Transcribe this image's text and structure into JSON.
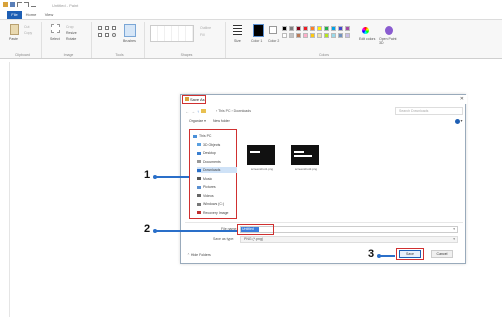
{
  "app": {
    "title": "Untitled - Paint"
  },
  "menu": {
    "file": "File",
    "tabs": [
      "Home",
      "View"
    ]
  },
  "ribbon": {
    "groups": [
      "Clipboard",
      "Image",
      "Tools",
      "Shapes",
      "Colors"
    ],
    "clipboard": {
      "paste": "Paste",
      "cut": "Cut",
      "copy": "Copy"
    },
    "image": {
      "select": "Select",
      "crop": "Crop",
      "resize": "Resize",
      "rotate": "Rotate"
    },
    "tools": {
      "brushes": "Brushes"
    },
    "shapes": {
      "outline": "Outline",
      "fill": "Fill"
    },
    "size_label": "Size",
    "color1_label": "Color 1",
    "color2_label": "Color 2",
    "edit_colors": "Edit colors",
    "paint3d": "Open Paint 3D",
    "palette": [
      "#000000",
      "#7f7f7f",
      "#880015",
      "#ed1c24",
      "#ff7f27",
      "#fff200",
      "#22b14c",
      "#00a2e8",
      "#3f48cc",
      "#a349a4",
      "#ffffff",
      "#c3c3c3",
      "#b97a57",
      "#ffaec9",
      "#ffc90e",
      "#efe4b0",
      "#b5e61d",
      "#99d9ea",
      "#7092be",
      "#c8bfe7"
    ]
  },
  "dialog": {
    "title": "Save As",
    "close_glyph": "✕",
    "nav_back": "←",
    "nav_forward": "→",
    "nav_up": "↑",
    "path": "› This PC › Downloads",
    "search_placeholder": "Search Downloads",
    "organize": "Organize ▾",
    "new_folder": "New folder",
    "view_glyph": "≡ ▾",
    "nav_items": [
      {
        "label": "This PC",
        "color": "#4a90d9"
      },
      {
        "label": "3D Objects",
        "color": "#5aa0e0"
      },
      {
        "label": "Desktop",
        "color": "#3a7fd0"
      },
      {
        "label": "Documents",
        "color": "#999999"
      },
      {
        "label": "Downloads",
        "color": "#2a6fc9"
      },
      {
        "label": "Music",
        "color": "#555555"
      },
      {
        "label": "Pictures",
        "color": "#5a8fd0"
      },
      {
        "label": "Videos",
        "color": "#666666"
      },
      {
        "label": "Windows (C:)",
        "color": "#777777"
      },
      {
        "label": "Recovery Image",
        "color": "#c03030"
      }
    ],
    "files": [
      {
        "name": "screenshot1.png"
      },
      {
        "name": "screenshot2.png"
      }
    ],
    "file_name_label": "File name:",
    "file_name_value": "Untitled",
    "save_type_label": "Save as type:",
    "save_type_value": "PNG (*.png)",
    "dropdown_glyph": "▾",
    "hide_folders": "⌃ Hide Folders",
    "save": "Save",
    "cancel": "Cancel"
  },
  "callouts": [
    "1",
    "2",
    "3"
  ],
  "colors": {
    "highlight_red": "#d03030",
    "callout_blue": "#2a6fc9",
    "file_tab_blue": "#1e5fb4"
  }
}
